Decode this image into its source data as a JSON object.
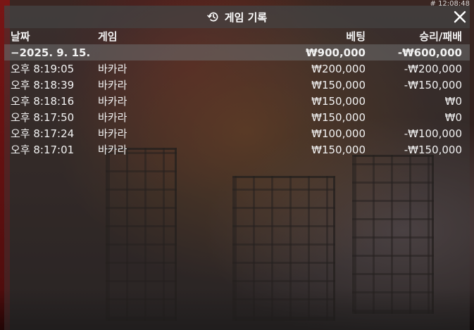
{
  "clock": "# 12:08:48",
  "panel": {
    "title": "게임 기록",
    "icons": {
      "history": "history-icon",
      "close": "close-icon"
    }
  },
  "table": {
    "headers": {
      "date": "날짜",
      "game": "게임",
      "bet": "베팅",
      "result": "승리/패배"
    },
    "summary": {
      "date": "−2025. 9. 15.",
      "bet": "₩900,000",
      "result": "-₩600,000"
    },
    "rows": [
      {
        "time": "오후 8:19:05",
        "game": "바카라",
        "bet": "₩200,000",
        "result": "-₩200,000"
      },
      {
        "time": "오후 8:18:39",
        "game": "바카라",
        "bet": "₩150,000",
        "result": "-₩150,000"
      },
      {
        "time": "오후 8:18:16",
        "game": "바카라",
        "bet": "₩150,000",
        "result": "₩0"
      },
      {
        "time": "오후 8:17:50",
        "game": "바카라",
        "bet": "₩150,000",
        "result": "₩0"
      },
      {
        "time": "오후 8:17:24",
        "game": "바카라",
        "bet": "₩100,000",
        "result": "-₩100,000"
      },
      {
        "time": "오후 8:17:01",
        "game": "바카라",
        "bet": "₩150,000",
        "result": "-₩150,000"
      }
    ]
  }
}
